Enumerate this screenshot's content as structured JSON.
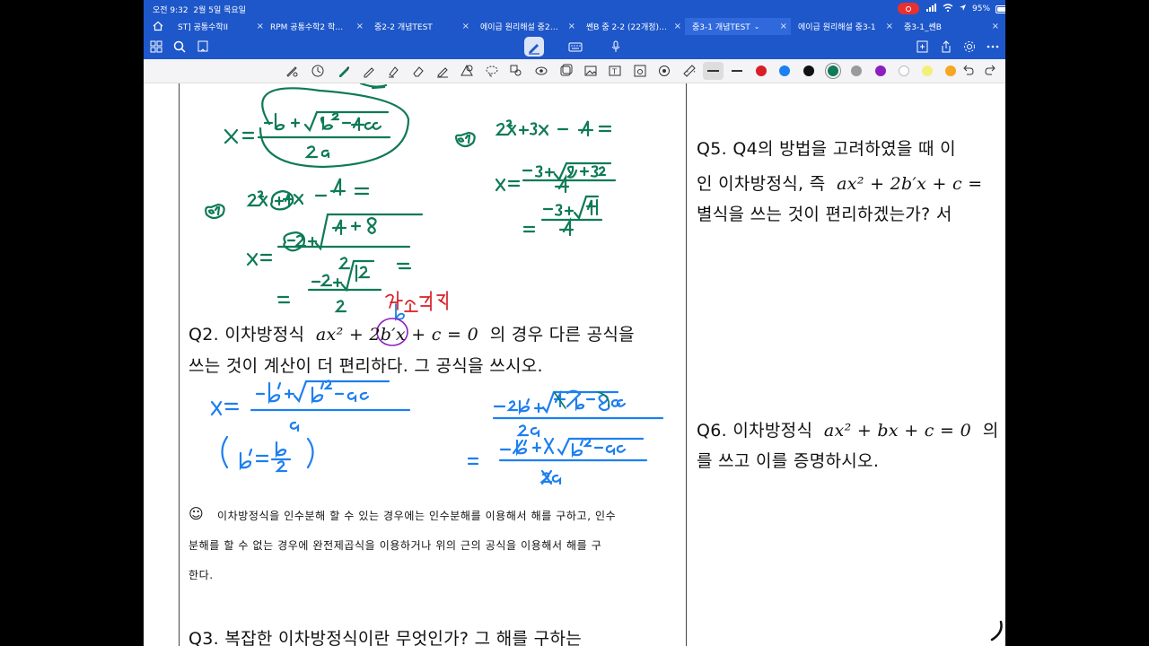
{
  "status": {
    "time": "오전 9:32",
    "date": "2월 5일 목요일",
    "battery": "95%"
  },
  "tabs": [
    {
      "label": "ST] 공통수학II",
      "active": false
    },
    {
      "label": "RPM 공통수학2 학…",
      "active": false
    },
    {
      "label": "중2-2 개념TEST",
      "active": false
    },
    {
      "label": "에이급 원리해설 중2…",
      "active": false
    },
    {
      "label": "쎈B 중 2-2 (22개정)…",
      "active": false
    },
    {
      "label": "중3-1 개념TEST",
      "active": true
    },
    {
      "label": "에이급 원리해설 중3-1",
      "active": false
    },
    {
      "label": "중3-1_쎈B",
      "active": false
    }
  ],
  "palette": {
    "colors": [
      "#d81f26",
      "#1d7ff0",
      "#111111",
      "#0e7a57",
      "#9a9a9a",
      "#8e1fbf",
      "#ffffff",
      "#f4ef7a",
      "#f5a623"
    ],
    "selected_index": 3
  },
  "left_page": {
    "q2": {
      "line1_prefix": "Q2. 이차방정식",
      "equation": "ax² + 2b′x + c = 0",
      "line1_suffix": "의 경우 다른 공식을",
      "line2": "쓰는 것이 계산이 더 편리하다. 그 공식을 쓰시오."
    },
    "note": {
      "emoji": "☺",
      "line1": "이차방정식을 인수분해 할 수 있는 경우에는 인수분해를 이용해서 해를 구하고, 인수",
      "line2": "분해를 할 수 없는 경우에 완전제곱식을 이용하거나 위의 근의 공식을 이용해서 해를 구",
      "line3": "한다."
    },
    "q3": {
      "text": "Q3. 복잡한 이차방정식이란 무엇인가? 그 해를 구하는"
    }
  },
  "right_page": {
    "q5": {
      "line1": "Q5. Q4의 방법을 고려하였을 때 이",
      "line2_prefix": "인 이차방정식, 즉",
      "line2_equation": "ax² + 2b′x + c =",
      "line3": "별식을 쓰는 것이 편리하겠는가? 서"
    },
    "q6": {
      "line1_prefix": "Q6. 이차방정식",
      "line1_equation": "ax² + bx + c = 0",
      "line1_suffix": "의",
      "line2": "를 쓰고 이를 증명하시오."
    }
  },
  "handwriting": {
    "formula_top": "x = (−b ± √(b²−4ac)) / 2a",
    "example1": "예) 2x² + 3x − 4 = 0",
    "example1_step1": "x = (−3 ± √(9+32)) / 4",
    "example1_step2": "= (−3 ± √41) / 4",
    "example2": "예) 2x² + 4x − 4 = 0",
    "example2_step1": "x = (−2 ± √(4+8)) / 2",
    "example2_step2": "= (−2 ± √12) / 2",
    "even_label": "짝수공식",
    "b_label": "b",
    "blue_formula": "x = (−b′ ± √(b′² − ac)) / a",
    "blue_condition": "(b′ = b/2)",
    "blue_derivation1": "(−2b′ ± √(4b′² − 4ac)) / 2a",
    "blue_derivation2": "= (−2b′ ± 2√(b′² − ac)) / 2a"
  }
}
